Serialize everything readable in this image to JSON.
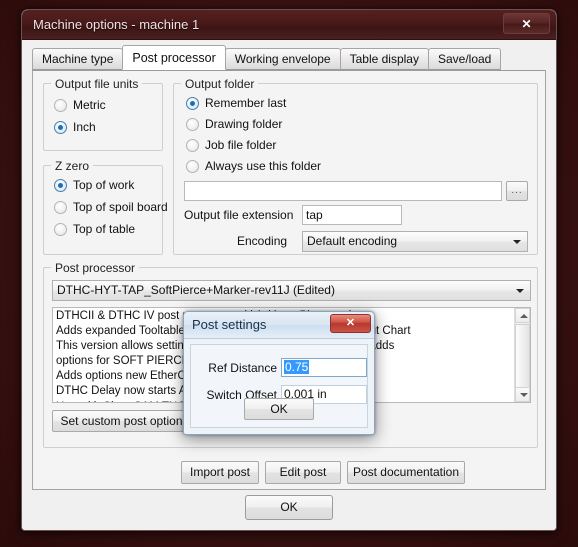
{
  "window": {
    "title": "Machine options - machine 1",
    "close_label": "✕"
  },
  "tabs": [
    {
      "label": "Machine type",
      "selected": false
    },
    {
      "label": "Post processor",
      "selected": true
    },
    {
      "label": "Working envelope",
      "selected": false
    },
    {
      "label": "Table display",
      "selected": false
    },
    {
      "label": "Save/load",
      "selected": false
    }
  ],
  "output_file_units": {
    "caption": "Output file units",
    "options": [
      {
        "label": "Metric",
        "selected": false
      },
      {
        "label": "Inch",
        "selected": true
      }
    ]
  },
  "z_zero": {
    "caption": "Z zero",
    "options": [
      {
        "label": "Top of work",
        "selected": true
      },
      {
        "label": "Top of spoil board",
        "selected": false
      },
      {
        "label": "Top of table",
        "selected": false
      }
    ]
  },
  "output_folder": {
    "caption": "Output folder",
    "options": [
      {
        "label": "Remember last",
        "selected": true
      },
      {
        "label": "Drawing folder",
        "selected": false
      },
      {
        "label": "Job file folder",
        "selected": false
      },
      {
        "label": "Always use this folder",
        "selected": false
      }
    ],
    "path_value": "",
    "browse_label": "...",
    "extension_label": "Output file extension",
    "extension_value": "tap",
    "encoding_label": "Encoding",
    "encoding_value": "Default encoding"
  },
  "post_processor": {
    "caption": "Post processor",
    "selected": "DTHC-HYT-TAP_SoftPierce+Marker-rev11J (Edited)",
    "description": "DTHCII & DTHC IV post processor with/without Plate marker\nAdds expanded Tooltable parameters (DCC) for Electronics Cut Chart\nThis version allows setting PC based THC for DTHCIV  on/offAdds\noptions for SOFT PIERCE ,  MULTIPASS and PECK\nAdds options new EtherCut dual head control\nDTHC Delay now starts AFTER the pierce delay\nUse with SheetCAM TNG version 6.1.16\nDesigned for use with Mach3 and DTHCII / DTHCIV with\nFloating head Touch-n-Go"
  },
  "buttons": {
    "set_custom_post_options": "Set custom post options",
    "import_post": "Import post",
    "edit_post": "Edit post",
    "post_documentation": "Post documentation",
    "ok": "OK"
  },
  "dialog": {
    "title": "Post settings",
    "close_label": "✕",
    "ref_distance_label": "Ref Distance",
    "ref_distance_value": "0.75",
    "switch_offset_label": "Switch Offset",
    "switch_offset_value": "0.001 in",
    "ok_label": "OK"
  },
  "colors": {
    "desktop_background": "#3a1111",
    "titlebar": "#491a1a",
    "selection_highlight": "#3399ff",
    "dialog_close_red": "#c74539"
  }
}
